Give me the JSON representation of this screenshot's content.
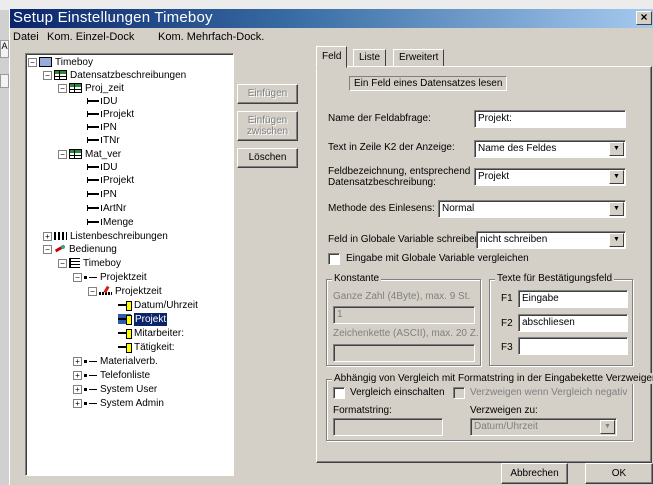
{
  "window": {
    "title": "Setup Einstellungen Timeboy",
    "close_glyph": "×"
  },
  "background": {
    "tab_letter": "A"
  },
  "menu": [
    "Datei",
    "Kom. Einzel-Dock",
    "Kom. Mehrfach-Dock."
  ],
  "tree": {
    "root": "Timeboy",
    "datensatz": "Datensatzbeschreibungen",
    "proj_zeit": "Proj_zeit",
    "proj_fields": [
      "DU",
      "Projekt",
      "PN",
      "TNr"
    ],
    "mat_ver": "Mat_ver",
    "mat_fields": [
      "DU",
      "Projekt",
      "PN",
      "ArtNr",
      "Menge"
    ],
    "listen": "Listenbeschreibungen",
    "bedienung": "Bedienung",
    "timeboy": "Timeboy",
    "projektzeit_menu": "Projektzeit",
    "projektzeit_edit": "Projektzeit",
    "edit_items": [
      "Datum/Uhrzeit",
      "Projekt",
      "Mitarbeiter:",
      "Tätigkeit:"
    ],
    "selected_item": "Projekt",
    "other_menus": [
      "Materialverb.",
      "Telefonliste",
      "System User",
      "System Admin"
    ]
  },
  "side_buttons": {
    "insert": "Einfügen",
    "insert_between_1": "Einfügen",
    "insert_between_2": "zwischen",
    "delete": "Löschen"
  },
  "tabs": [
    "Feld",
    "Liste",
    "Erweitert"
  ],
  "panel": {
    "info": "Ein Feld eines Datensatzes lesen",
    "name_label": "Name der Feldabfrage:",
    "name_value": "Projekt:",
    "k2_label": "Text in Zeile K2 der Anzeige:",
    "k2_value": "Name des Feldes",
    "feld_label_1": "Feldbezeichnung, entsprechend",
    "feld_label_2": "Datensatzbeschreibung:",
    "feld_value": "Projekt",
    "methode_label": "Methode des Einlesens:",
    "methode_value": "Normal",
    "global_label": "Feld in Globale Variable schreiben",
    "global_value": "nicht schreiben",
    "compare_label": "Eingabe mit Globale Variable vergleichen",
    "konst_title": "Konstante",
    "int_label": "Ganze Zahl (4Byte), max. 9 St.",
    "int_value": "1",
    "str_label": "Zeichenkette (ASCII), max. 20 Z.",
    "str_value": "",
    "texte_title": "Texte für Bestätigungsfeld",
    "f1_label": "F1",
    "f1_value": "Eingabe",
    "f2_label": "F2",
    "f2_value": "abschliesen",
    "f3_label": "F3",
    "f3_value": "",
    "branch_title": "Abhängig von Vergleich mit Formatstring in der Eingabekette Verzweigen",
    "cmp_on": "Vergleich einschalten",
    "branch_neg": "Verzweigen wenn Vergleich negativ",
    "format_label": "Formatstring:",
    "format_value": "",
    "branch_to_label": "Verzweigen zu:",
    "branch_to_value": "Datum/Uhrzeit"
  },
  "footer": {
    "cancel": "Abbrechen",
    "ok": "OK"
  }
}
